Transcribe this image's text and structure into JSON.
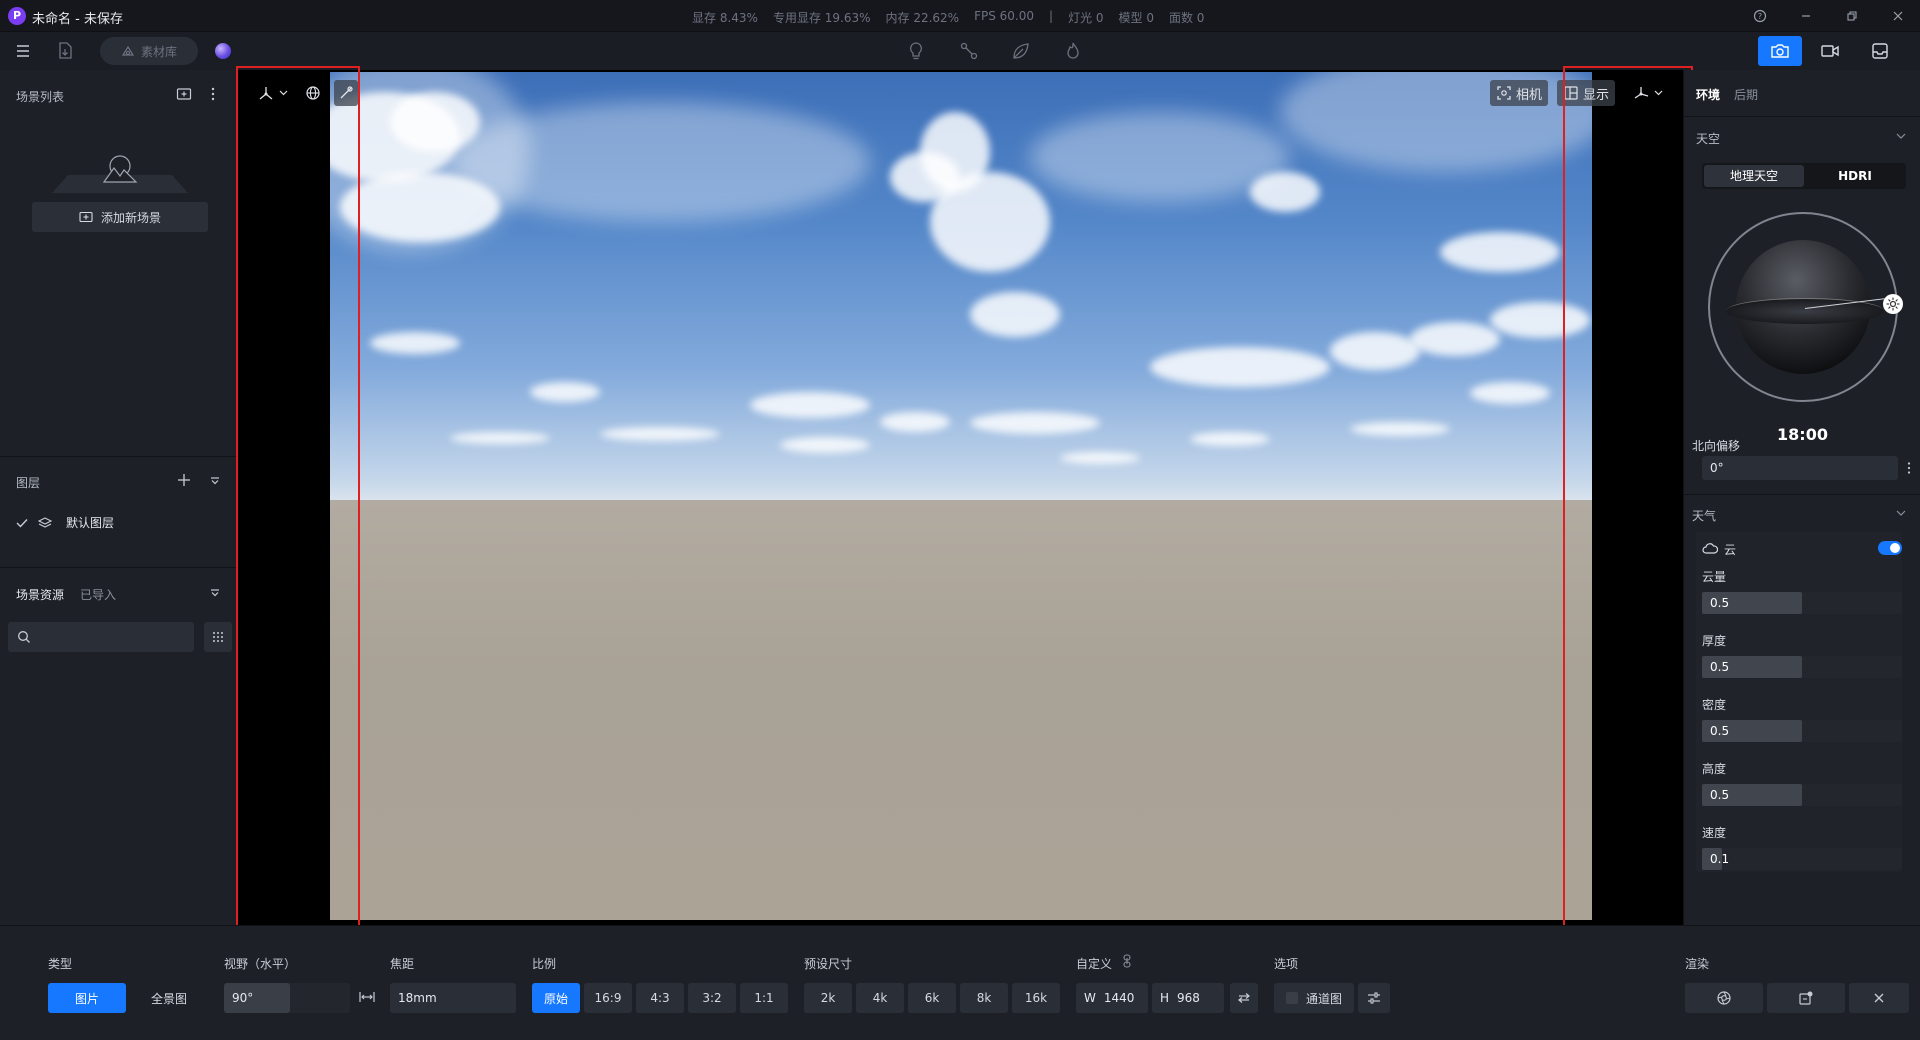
{
  "title_bar": {
    "app_title": "未命名 - 未保存",
    "logo_letter": "P",
    "stats": [
      "显存 8.43%",
      "专用显存 19.63%",
      "内存 22.62%",
      "FPS 60.00",
      "|",
      "灯光 0",
      "模型 0",
      "面数 0"
    ]
  },
  "toolbar": {
    "material_library_label": "素材库"
  },
  "left_panel": {
    "scene_list_title": "场景列表",
    "add_scene_label": "添加新场景",
    "layers_title": "图层",
    "default_layer_label": "默认图层",
    "assets_tab_scene": "场景资源",
    "assets_tab_imported": "已导入",
    "search_placeholder": ""
  },
  "viewport": {
    "camera_label": "相机",
    "display_label": "显示"
  },
  "right_panel": {
    "tab_environment": "环境",
    "tab_post": "后期",
    "sky_section": "天空",
    "sky_mode_geo": "地理天空",
    "sky_mode_hdri": "HDRI",
    "time_value": "18:00",
    "north_offset_label": "北向偏移",
    "north_offset_value": "0°",
    "weather_section": "天气",
    "cloud_label": "云",
    "cloud_enabled": true,
    "params": [
      {
        "label": "云量",
        "value": "0.5",
        "fraction": 0.5
      },
      {
        "label": "厚度",
        "value": "0.5",
        "fraction": 0.5
      },
      {
        "label": "密度",
        "value": "0.5",
        "fraction": 0.5
      },
      {
        "label": "高度",
        "value": "0.5",
        "fraction": 0.5
      },
      {
        "label": "速度",
        "value": "0.1",
        "fraction": 0.1
      }
    ]
  },
  "bottom_bar": {
    "type_label": "类型",
    "type_photo": "图片",
    "type_panorama": "全景图",
    "fov_label": "视野（水平）",
    "fov_value": "90°",
    "focal_label": "焦距",
    "focal_value": "18mm",
    "ratio_label": "比例",
    "ratios": [
      "原始",
      "16:9",
      "4:3",
      "3:2",
      "1:1"
    ],
    "preset_label": "预设尺寸",
    "presets": [
      "2k",
      "4k",
      "6k",
      "8k",
      "16k"
    ],
    "custom_label": "自定义",
    "width_prefix": "W",
    "width_value": "1440",
    "height_prefix": "H",
    "height_value": "968",
    "options_label": "选项",
    "channel_label": "通道图",
    "render_label": "渲染"
  },
  "colors": {
    "accent": "#1677ff",
    "highlight_box": "#e02020",
    "panel_bg": "#1d2027"
  }
}
